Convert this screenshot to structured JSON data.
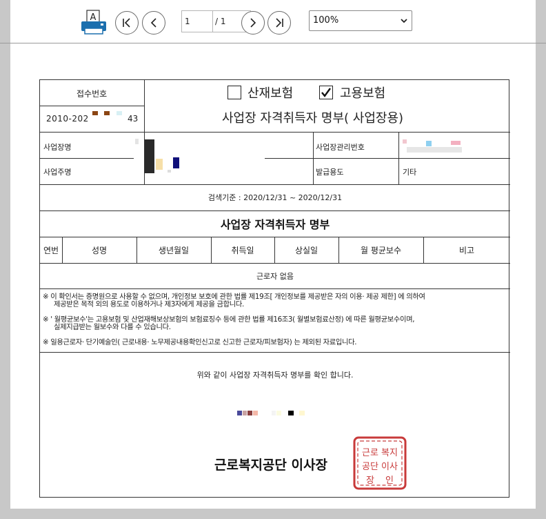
{
  "toolbar": {
    "print_label": "A",
    "page_current": "1",
    "page_total": "/ 1",
    "zoom": "100%"
  },
  "document": {
    "receipt_label": "접수번호",
    "receipt_prefix": "2010-202",
    "receipt_suffix": "43",
    "insurance_industrial": "산재보험",
    "insurance_employment": "고용보험",
    "industrial_checked": false,
    "employment_checked": true,
    "title": "사업장 자격취득자 명부( 사업장용)",
    "workplace_name_label": "사업장명",
    "workplace_mgmt_no_label": "사업장관리번호",
    "workplace_owner_label": "사업주명",
    "issue_purpose_label": "발급용도",
    "issue_purpose_value": "기타",
    "search_criteria": "검색기준 : 2020/12/31 ~ 2020/12/31",
    "list_title": "사업장 자격취득자 명부",
    "columns": [
      "연번",
      "성명",
      "생년월일",
      "취득일",
      "상실일",
      "월 평균보수",
      "비고"
    ],
    "empty_text": "근로자 없음",
    "notices": [
      [
        "※ 이 확인서는 증명원으로 사용할 수 없으며, 개인정보 보호에 관한 법률 제19조[ 개인정보를 제공받은 자의 이용· 제공 제한] 에 의하여",
        "제공받은 목적 외의 용도로 이용하거나 제3자에게 제공을 금합니다."
      ],
      [
        "※ ' 월평균보수'는 고용보험 및 산업재해보상보험의 보험료징수 등에 관한 법률 제16조3( 월별보험료산정) 에 따른 월평균보수이며,",
        "실제지급받는 월보수와 다를 수 있습니다."
      ],
      [
        "※  일용근로자· 단기예술인( 근로내용· 노무제공내용확인신고로 신고한 근로자/피보험자) 는 제외된 자료입니다."
      ]
    ],
    "confirm_text": "위와 같이 사업장 자격취득자 명부를 확인 합니다.",
    "issuer": "근로복지공단 이사장",
    "seal_chars": [
      "근로",
      "복지",
      "공단",
      "이사",
      "장",
      "인"
    ]
  },
  "colors": {
    "background": "#c8c8c8",
    "seal_red": "#c83a3a",
    "print_icon_blue": "#1b6fae"
  }
}
